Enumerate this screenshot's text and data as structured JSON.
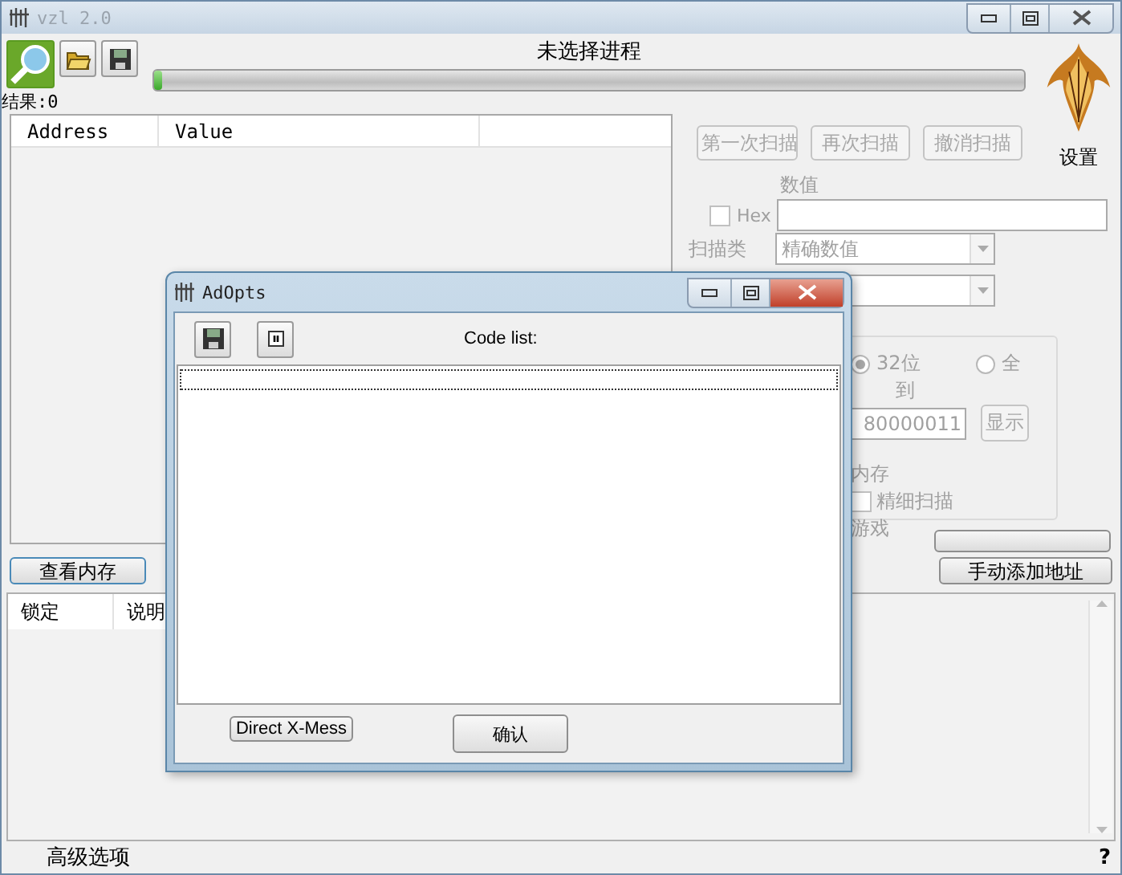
{
  "window": {
    "title": "vzl 2.0"
  },
  "process_title": "未选择进程",
  "progress": {
    "level": 0.01
  },
  "result_label": "结果:0",
  "results_table": {
    "columns": [
      "Address",
      "Value"
    ]
  },
  "scan_buttons": [
    {
      "label": "第一次扫描",
      "disabled": true
    },
    {
      "label": "再次扫描",
      "disabled": true
    },
    {
      "label": "撤消扫描",
      "disabled": true
    }
  ],
  "settings_label": "设置",
  "value_label": "数值",
  "hex": {
    "label": "Hex",
    "checked": false,
    "disabled": true
  },
  "scan_type": {
    "label": "扫描类",
    "value": "精确数值"
  },
  "range": {
    "options": [
      {
        "label": "32位",
        "selected": true
      },
      {
        "label": "全",
        "selected": false
      }
    ],
    "to_label": "到",
    "to_value": "80000011",
    "show_button": "显示"
  },
  "options": [
    {
      "kind": "label",
      "label": "内存"
    },
    {
      "kind": "checkbox",
      "label": "精细扫描",
      "checked": false
    },
    {
      "kind": "label",
      "label": "游戏"
    }
  ],
  "view_memory_button": "查看内存",
  "add_address_button": "手动添加地址",
  "cheat_table": {
    "columns": [
      "锁定",
      "说明"
    ]
  },
  "advanced_label": "高级选项",
  "help_label": "?",
  "dialog": {
    "title": "AdOpts",
    "list_label": "Code list:",
    "buttons": [
      "Direct X-Mess",
      "确认"
    ]
  }
}
